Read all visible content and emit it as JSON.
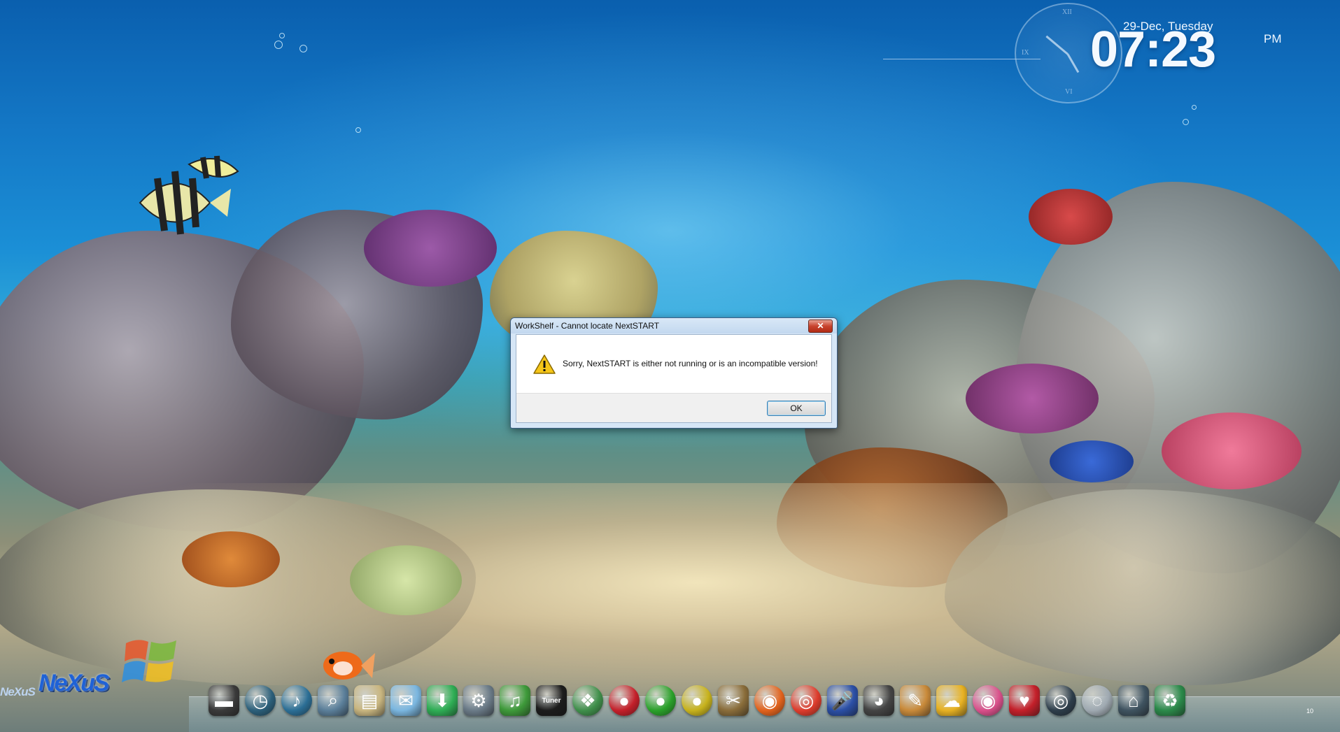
{
  "dialog": {
    "title": "WorkShelf - Cannot locate NextSTART",
    "message": "Sorry, NextSTART is either not running or is an incompatible version!",
    "ok_label": "OK",
    "close_label": "✕",
    "icon": "warning-icon"
  },
  "clock": {
    "date": "29-Dec, Tuesday",
    "time": "07:23",
    "ampm": "PM",
    "numerals": {
      "top": "XII",
      "left": "IX",
      "bottom": "VI"
    }
  },
  "dock": {
    "logo_text": "NeXuS",
    "logo_small": "NeXuS",
    "tuner_label": "Tuner",
    "tray_number": "10",
    "icons": [
      {
        "name": "folder-icon",
        "color": "#3a3a3a"
      },
      {
        "name": "clock-icon",
        "color": "#2b5f7a"
      },
      {
        "name": "volume-icon",
        "color": "#2b6e95"
      },
      {
        "name": "search-icon",
        "color": "#5b7f9a"
      },
      {
        "name": "notes-icon",
        "color": "#c9b680"
      },
      {
        "name": "mail-icon",
        "color": "#7bb7e0"
      },
      {
        "name": "download-icon",
        "color": "#2fae55"
      },
      {
        "name": "settings-icon",
        "color": "#6b7b88"
      },
      {
        "name": "music-icon",
        "color": "#3e9a3a"
      },
      {
        "name": "tuner-icon",
        "color": "#1c1c1c"
      },
      {
        "name": "windows-start-icon",
        "color": "#3f8f4a"
      },
      {
        "name": "red-orb-icon",
        "color": "#c4202a"
      },
      {
        "name": "green-orb-icon",
        "color": "#2aa12a"
      },
      {
        "name": "yellow-orb-icon",
        "color": "#c7b21c"
      },
      {
        "name": "tools-icon",
        "color": "#8a6d3a"
      },
      {
        "name": "firefox-icon",
        "color": "#e2621c"
      },
      {
        "name": "chrome-icon",
        "color": "#dd3c2c"
      },
      {
        "name": "microphone-icon",
        "color": "#2b4fa6"
      },
      {
        "name": "panda-icon",
        "color": "#444444"
      },
      {
        "name": "paint-icon",
        "color": "#c98a3a"
      },
      {
        "name": "weather-icon",
        "color": "#e8b223"
      },
      {
        "name": "disc-icon",
        "color": "#d94f8a"
      },
      {
        "name": "heart-monitor-icon",
        "color": "#c4202a"
      },
      {
        "name": "camera-icon",
        "color": "#2d3d4a"
      },
      {
        "name": "dvd-icon",
        "color": "#9fa9b1"
      },
      {
        "name": "network-icon",
        "color": "#3f5360"
      },
      {
        "name": "recycle-bin-icon",
        "color": "#2b8a4a"
      }
    ]
  }
}
